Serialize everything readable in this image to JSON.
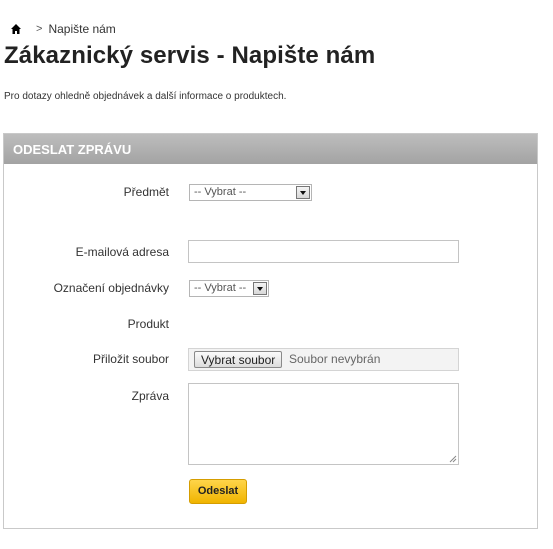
{
  "breadcrumb": {
    "home_icon": "home-icon",
    "separator": ">",
    "current": "Napište nám"
  },
  "page": {
    "title": "Zákaznický servis - Napište nám",
    "intro": "Pro dotazy ohledně objednávek a další informace o produktech."
  },
  "form": {
    "header": "ODESLAT ZPRÁVU",
    "subject_label": "Předmět",
    "subject_selected": "-- Vybrat --",
    "email_label": "E-mailová adresa",
    "email_value": "",
    "order_label": "Označení objednávky",
    "order_selected": "-- Vybrat --",
    "product_label": "Produkt",
    "file_label": "Přiložit soubor",
    "file_button": "Vybrat soubor",
    "file_status": "Soubor nevybrán",
    "message_label": "Zpráva",
    "message_value": "",
    "submit_label": "Odeslat"
  },
  "colors": {
    "header_bg": "#a8a8a8",
    "submit_bg": "#f5c020",
    "border": "#c9c9c9"
  }
}
